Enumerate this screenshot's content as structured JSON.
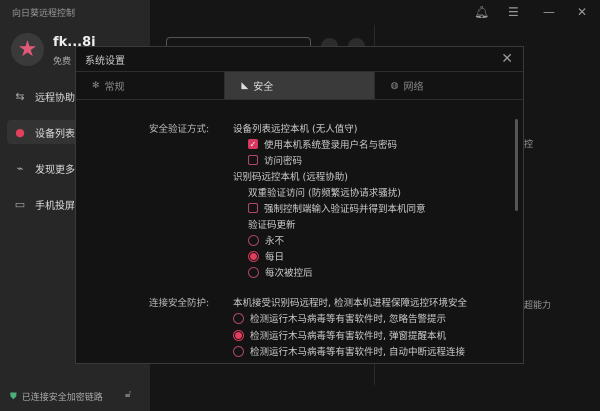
{
  "app": {
    "title": "向日葵远程控制",
    "user": "fk...8i",
    "plan": "免费",
    "secure_status": "已连接安全加密链路"
  },
  "sidebar": {
    "items": [
      {
        "label": "远程协助",
        "icon": "remote-assist-icon"
      },
      {
        "label": "设备列表",
        "icon": "device-list-icon",
        "active": true
      },
      {
        "label": "发现更多",
        "icon": "satellite-icon"
      },
      {
        "label": "手机投屏",
        "icon": "screen-cast-icon"
      }
    ]
  },
  "background": {
    "right_text_1": "控",
    "right_text_2": "超能力"
  },
  "dialog": {
    "title": "系统设置",
    "tabs": [
      {
        "label": "常规",
        "icon": "gear-icon"
      },
      {
        "label": "安全",
        "icon": "shield-icon",
        "active": true
      },
      {
        "label": "网络",
        "icon": "globe-icon"
      }
    ],
    "auth": {
      "label": "安全验证方式:",
      "device_list_heading": "设备列表远控本机 (无人值守)",
      "opt_system_login": {
        "label": "使用本机系统登录用户名与密码",
        "checked": true
      },
      "opt_access_password": {
        "label": "访问密码",
        "checked": false
      },
      "code_heading": "识别码远控本机 (远程协助)",
      "double_verify": "双重验证访问 (防频繁远协请求骚扰)",
      "opt_force_code": {
        "label": "强制控制端输入验证码并得到本机同意",
        "checked": false
      },
      "code_update_label": "验证码更新",
      "code_update_options": [
        "永不",
        "每日",
        "每次被控后"
      ],
      "code_update_selected": "每日"
    },
    "protection": {
      "label": "连接安全防护:",
      "desc": "本机接受识别码远程时, 检测本机进程保障远控环境安全",
      "options": [
        "检测运行木马病毒等有害软件时, 忽略告警提示",
        "检测运行木马病毒等有害软件时, 弹窗提醒本机",
        "检测运行木马病毒等有害软件时, 自动中断远程连接"
      ],
      "selected": "检测运行木马病毒等有害软件时, 弹窗提醒本机"
    }
  },
  "colors": {
    "accent": "#e0405e",
    "secure": "#4caf7a"
  }
}
